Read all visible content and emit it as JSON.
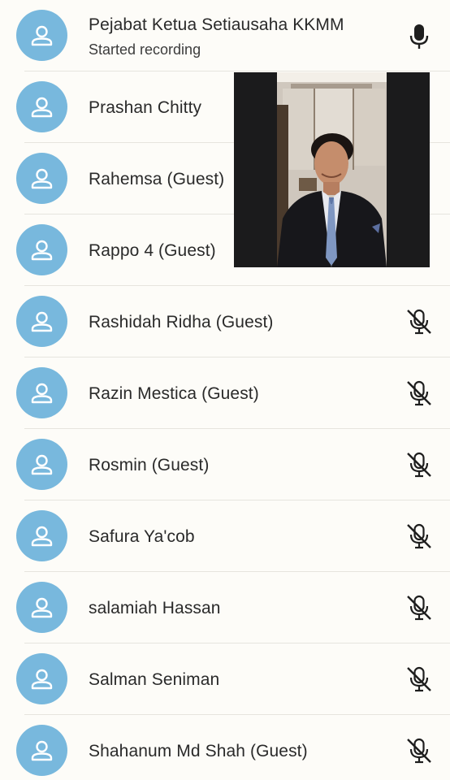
{
  "participants": [
    {
      "name": "Pejabat Ketua Setiausaha KKMM",
      "status": "Started recording",
      "mic": "unmuted"
    },
    {
      "name": "Prashan Chitty",
      "mic": "hidden"
    },
    {
      "name": "Rahemsa (Guest)",
      "mic": "hidden"
    },
    {
      "name": "Rappo 4 (Guest)",
      "mic": "hidden"
    },
    {
      "name": "Rashidah Ridha (Guest)",
      "mic": "muted"
    },
    {
      "name": "Razin Mestica (Guest)",
      "mic": "muted"
    },
    {
      "name": "Rosmin (Guest)",
      "mic": "muted"
    },
    {
      "name": "Safura Ya'cob",
      "mic": "muted"
    },
    {
      "name": "salamiah Hassan",
      "mic": "muted"
    },
    {
      "name": "Salman Seniman",
      "mic": "muted"
    },
    {
      "name": "Shahanum Md Shah (Guest)",
      "mic": "muted"
    }
  ],
  "icons": {
    "avatar": "person-icon",
    "mic_on": "microphone-icon",
    "mic_off": "microphone-muted-icon"
  },
  "colors": {
    "avatar_bg": "#78b8dd",
    "background": "#fdfcf8",
    "text": "#2a2a2a"
  },
  "video": {
    "description_icon": "video-thumbnail"
  }
}
